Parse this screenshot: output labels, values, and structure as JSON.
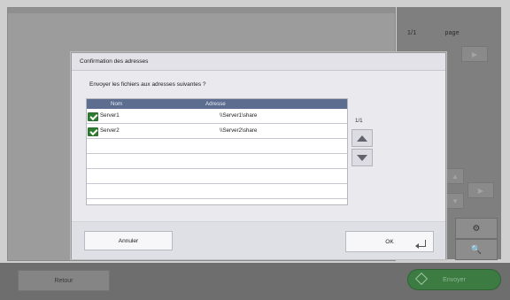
{
  "background": {
    "page_fraction": "1/1",
    "page_label": "page"
  },
  "bottom_bar": {
    "back_label": "Retour",
    "send_label": "Envoyer"
  },
  "dialog": {
    "title": "Confirmation des adresses",
    "question": "Envoyer les fichiers aux adresses suivantes ?",
    "columns": [
      "Nom",
      "Adresse"
    ],
    "rows": [
      {
        "checked": true,
        "name": "Server1",
        "address": "\\\\Server1\\share"
      },
      {
        "checked": true,
        "name": "Server2",
        "address": "\\\\Server2\\share"
      }
    ],
    "empty_rows": 4,
    "page_indicator": "1/1",
    "cancel_label": "Annuler",
    "ok_label": "OK"
  },
  "colors": {
    "table_header": "#5d6d8f",
    "send_button": "#3c7b42",
    "check": "#2d7d2f"
  },
  "icons": [
    "check-icon",
    "scroll-up-icon",
    "scroll-down-icon",
    "enter-icon",
    "send-icon",
    "zoom-icon",
    "settings-icon"
  ]
}
